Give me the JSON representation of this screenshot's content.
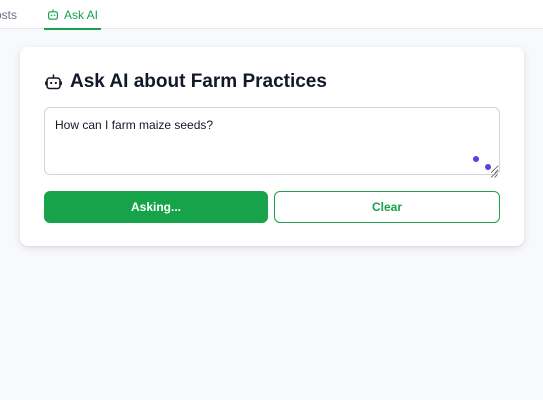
{
  "tabs": [
    {
      "label": "osts",
      "icon": "posts-icon",
      "active": false
    },
    {
      "label": "Ask AI",
      "icon": "robot-icon",
      "active": true
    }
  ],
  "colors": {
    "accent": "#16a34a",
    "typing_indicator": "#5b3fe0"
  },
  "card": {
    "title": "Ask AI about Farm Practices",
    "title_icon": "robot-icon",
    "question_value": "How can I farm maize seeds?",
    "ask_button_label": "Asking...",
    "clear_button_label": "Clear"
  }
}
